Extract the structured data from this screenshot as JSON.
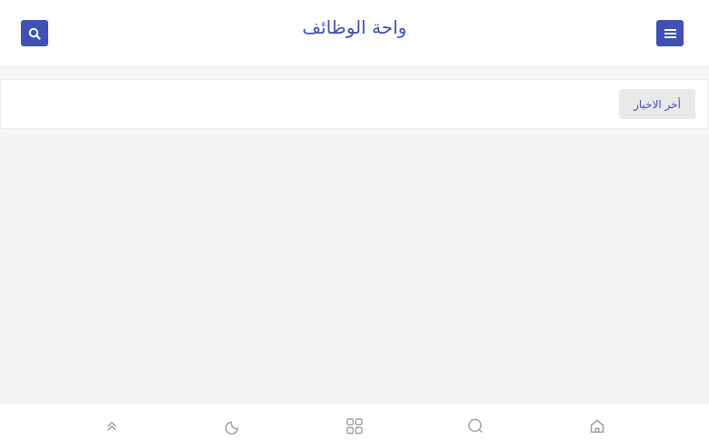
{
  "header": {
    "site_title": "واحة الوظائف",
    "search_icon": "search-icon",
    "menu_icon": "menu-icon"
  },
  "ticker": {
    "label": "أخر الاخبار"
  },
  "bottom_nav": {
    "items": [
      {
        "icon": "scroll-top-icon"
      },
      {
        "icon": "dark-mode-icon"
      },
      {
        "icon": "grid-icon"
      },
      {
        "icon": "search-icon"
      },
      {
        "icon": "home-icon"
      }
    ]
  },
  "colors": {
    "accent": "#3f51b5",
    "page_bg": "#f5f5f5",
    "icon_gray": "#9e9e9e"
  }
}
